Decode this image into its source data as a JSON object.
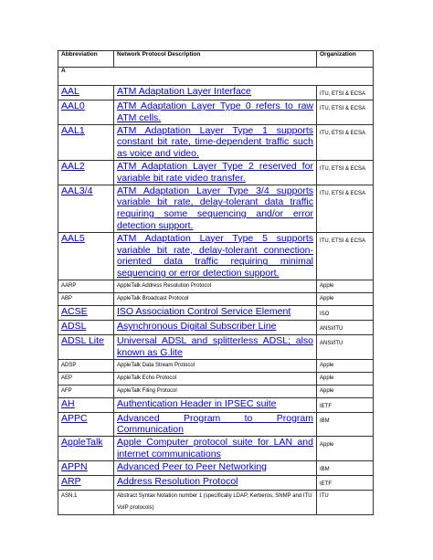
{
  "table": {
    "headers": {
      "abbreviation": "Abbreviation",
      "description": "Network Protocol Description",
      "organization": "Organization"
    },
    "section": "A",
    "rows": [
      {
        "abbr": "AAL",
        "desc": "ATM Adaptation Layer Interface",
        "org": "ITU, ETSI & ECSA",
        "style": "big"
      },
      {
        "abbr": "AAL0",
        "desc": "ATM Adaptation Layer Type 0 refers to raw ATM cells.",
        "org": "ITU, ETSI & ECSA",
        "style": "big"
      },
      {
        "abbr": "AAL1",
        "desc": "ATM Adaptation Layer Type 1 supports constant bit rate, time-dependent traffic such as voice and video.",
        "org": "ITU, ETSI & ECSA",
        "style": "big"
      },
      {
        "abbr": "AAL2",
        "desc": "ATM Adaptation Layer Type 2 reserved for variable bit rate video transfer.",
        "org": "ITU, ETSI & ECSA",
        "style": "big"
      },
      {
        "abbr": "AAL3/4",
        "desc": "ATM Adaptation Layer Type 3/4 supports variable bit rate, delay-tolerant data traffic requiring some sequencing and/or error detection support.",
        "org": "ITU, ETSI & ECSA",
        "style": "big"
      },
      {
        "abbr": "AAL5",
        "desc": "ATM Adaptation Layer Type 5 supports variable bit rate, delay-tolerant connection-oriented data traffic requiring minimal sequencing or error detection support.",
        "org": "ITU, ETSI & ECSA",
        "style": "big"
      },
      {
        "abbr": "AARP",
        "desc": "AppleTalk Address Resolution Protocol",
        "org": "Apple",
        "style": "small"
      },
      {
        "abbr": "ABP",
        "desc": "AppleTalk Broadcast Protocol",
        "org": "Apple",
        "style": "small"
      },
      {
        "abbr": "ACSE",
        "desc": "ISO Association Control Service Element",
        "org": "ISO",
        "style": "big"
      },
      {
        "abbr": "ADSL",
        "desc": "Asynchronous Digital Subscriber Line",
        "org": "ANSI/ITU",
        "style": "big"
      },
      {
        "abbr": "ADSL Lite",
        "desc": "Universal ADSL and splitterless ADSL; also known as G.lite",
        "org": "ANSI/ITU",
        "style": "big"
      },
      {
        "abbr": "ADSP",
        "desc": "AppleTalk Data Stream Protocol",
        "org": "Apple",
        "style": "small"
      },
      {
        "abbr": "AEP",
        "desc": "AppleTalk Echo Protocol",
        "org": "Apple",
        "style": "small"
      },
      {
        "abbr": "AFP",
        "desc": "AppleTalk Filing Protocol",
        "org": "Apple",
        "style": "small"
      },
      {
        "abbr": "AH",
        "desc": "Authentication Header in IPSEC suite",
        "org": "IETF",
        "style": "big"
      },
      {
        "abbr": "APPC",
        "desc": "Advanced Program to Program Communication",
        "org": "IBM",
        "style": "big"
      },
      {
        "abbr": "AppleTalk",
        "desc": "Apple Computer protocol suite for LAN and internet communications",
        "org": "Apple",
        "style": "big"
      },
      {
        "abbr": "APPN",
        "desc": "Advanced Peer to Peer Networking",
        "org": "IBM",
        "style": "big"
      },
      {
        "abbr": "ARP",
        "desc": "Address Resolution Protocol",
        "org": "IETF",
        "style": "big"
      },
      {
        "abbr": "ASN.1",
        "desc": "Abstract Syntax Notation number 1 (specifically LDAP, Kerberos, SNMP and ITU VoIP protocols)",
        "org": "ITU",
        "style": "small"
      }
    ]
  }
}
